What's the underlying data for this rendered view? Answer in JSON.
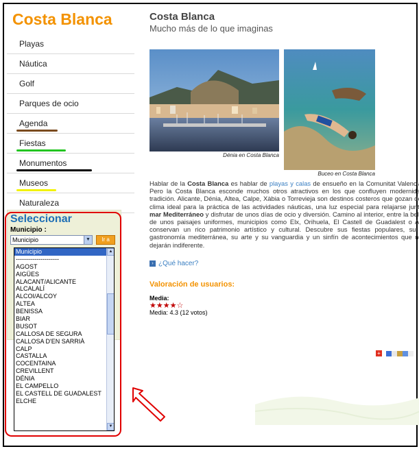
{
  "sidebar": {
    "title": "Costa Blanca",
    "items": [
      {
        "label": "Playas"
      },
      {
        "label": "Náutica"
      },
      {
        "label": "Golf"
      },
      {
        "label": "Parques de ocio"
      },
      {
        "label": "Agenda",
        "underline": "#7a4a1e"
      },
      {
        "label": "Fiestas",
        "underline": "#22c420"
      },
      {
        "label": "Monumentos",
        "underline": "#000000"
      },
      {
        "label": "Museos",
        "underline": "#f2f200"
      },
      {
        "label": "Naturaleza"
      }
    ]
  },
  "selector": {
    "title": "Seleccionar",
    "label": "Municipio :",
    "selected": "Municipio",
    "go_button": "Ir a",
    "options": [
      "Municipio",
      "---------------------",
      "AGOST",
      "AIGÜES",
      "ALACANT/ALICANTE",
      "ALCALALÍ",
      "ALCOI/ALCOY",
      "ALTEA",
      "BENISSA",
      "BIAR",
      "BUSOT",
      "CALLOSA DE SEGURA",
      "CALLOSA D'EN SARRIÀ",
      "CALP",
      "CASTALLA",
      "COCENTAINA",
      "CREVILLENT",
      "DÉNIA",
      "EL CAMPELLO",
      "EL CASTELL DE GUADALEST",
      "ELCHE"
    ]
  },
  "main": {
    "title": "Costa Blanca",
    "subtitle": "Mucho más de lo que imaginas",
    "caption1": "Dénia en Costa Blanca",
    "caption2": "Buceo en Costa Blanca",
    "body_1": "Hablar de la ",
    "body_bold1": "Costa Blanca",
    "body_2": " es hablar de ",
    "body_link": "playas y calas",
    "body_3": " de ensueño en la Comunitat Valenciana. Pero la Costa Blanca esconde muchos otros atractivos en los que confluyen modernidad y tradición. Alicante, Dénia, Altea, Calpe, Xàbia o Torrevieja son destinos costeros que gozan de un clima ideal para la práctica de las actividades náuticas, una luz especial para relajarse junto al ",
    "body_bold2": "mar Mediterráneo",
    "body_4": " y disfrutar de unos días de ocio y diversión. Camino al interior, entre la belleza de unos paisajes uniformes, municipios como Elx, Orihuela, El Castell de Guadalest o Alcoy conservan un rico patrimonio artístico y cultural. Descubre sus fiestas populares, su rica gastronomía mediterránea, su arte y su vanguardia y un sinfín de acontecimientos que no te dejarán indiferente.",
    "que_hacer": "¿Qué hacer?",
    "rating_title": "Valoración de usuarios:",
    "media_label": "Media:",
    "stars": "★★★★☆",
    "rating_value": 4.3,
    "rating_text": "Media: 4.3 (12 votos)"
  },
  "colors": {
    "accent": "#f39200",
    "link": "#3a7fc2",
    "select_title": "#1f6fb5",
    "highlight": "#e00000"
  }
}
